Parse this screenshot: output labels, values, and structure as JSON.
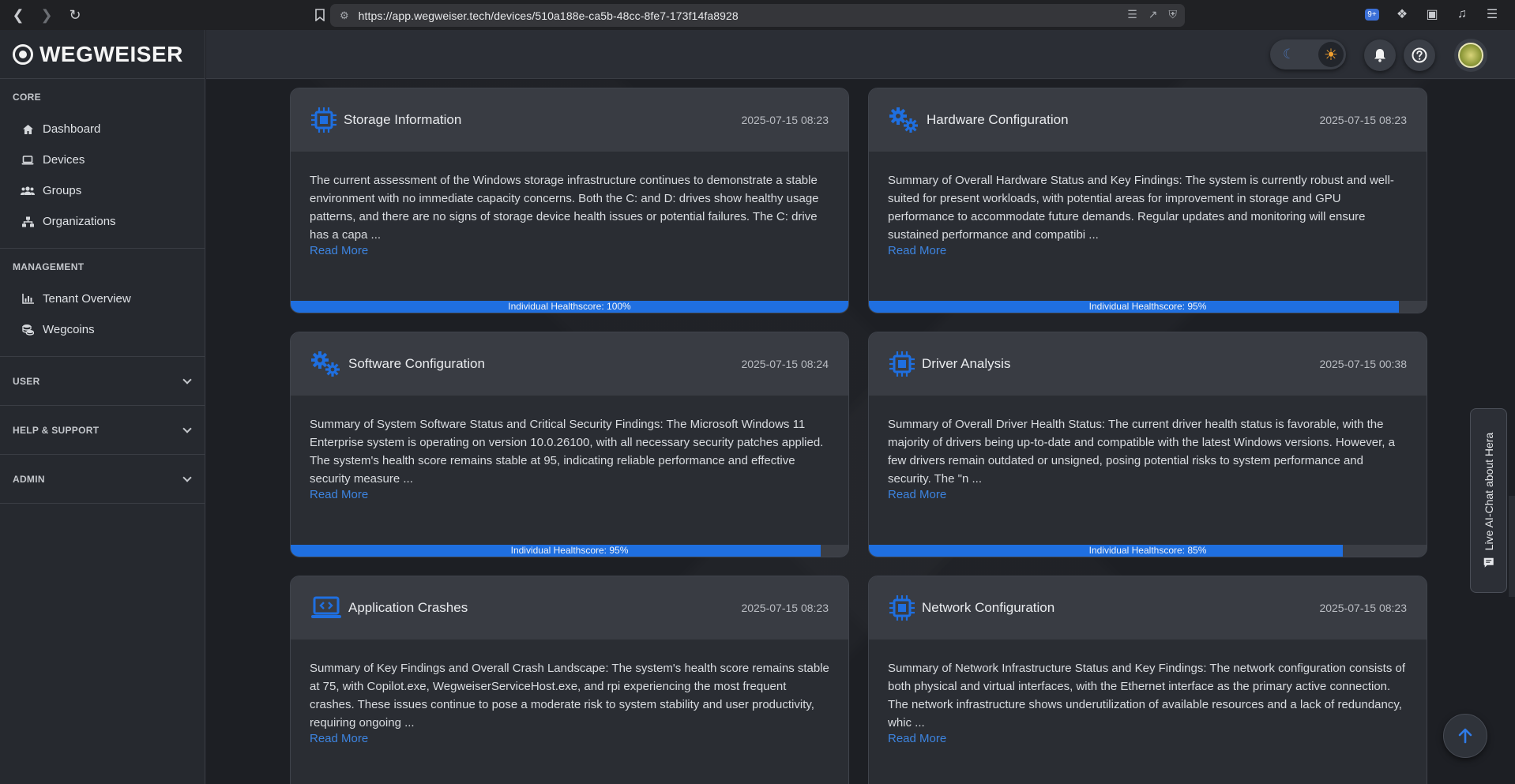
{
  "browser": {
    "url": "https://app.wegweiser.tech/devices/510a188e-ca5b-48cc-8fe7-173f14fa8928",
    "ext_badge": "9+"
  },
  "brand": {
    "name": "WEGWEISER"
  },
  "sidebar": {
    "core": {
      "heading": "CORE",
      "items": [
        {
          "label": "Dashboard",
          "icon": "home-icon"
        },
        {
          "label": "Devices",
          "icon": "laptop-icon"
        },
        {
          "label": "Groups",
          "icon": "users-icon"
        },
        {
          "label": "Organizations",
          "icon": "sitemap-icon"
        }
      ]
    },
    "management": {
      "heading": "MANAGEMENT",
      "items": [
        {
          "label": "Tenant Overview",
          "icon": "chart-icon"
        },
        {
          "label": "Wegcoins",
          "icon": "coins-icon"
        }
      ]
    },
    "collapsibles": [
      "USER",
      "HELP & SUPPORT",
      "ADMIN"
    ]
  },
  "cards": [
    {
      "title": "Storage Information",
      "icon": "chip-icon",
      "date": "2025-07-15 08:23",
      "text": "The current assessment of the Windows storage infrastructure continues to demonstrate a stable environment with no immediate capacity concerns. Both the C: and D: drives show healthy usage patterns, and there are no signs of storage device health issues or potential failures. The C: drive has a capa ...",
      "read_more": "Read More",
      "score_label": "Individual Healthscore: 100%",
      "score": 100
    },
    {
      "title": "Hardware Configuration",
      "icon": "gears-icon",
      "date": "2025-07-15 08:23",
      "text": "Summary of Overall Hardware Status and Key Findings: The system is currently robust and well-suited for present workloads, with potential areas for improvement in storage and GPU performance to accommodate future demands. Regular updates and monitoring will ensure sustained performance and compatibi ...",
      "read_more": "Read More",
      "score_label": "Individual Healthscore: 95%",
      "score": 95
    },
    {
      "title": "Software Configuration",
      "icon": "gears-icon",
      "date": "2025-07-15 08:24",
      "text": "Summary of System Software Status and Critical Security Findings: The Microsoft Windows 11 Enterprise system is operating on version 10.0.26100, with all necessary security patches applied. The system's health score remains stable at 95, indicating reliable performance and effective security measure ...",
      "read_more": "Read More",
      "score_label": "Individual Healthscore: 95%",
      "score": 95
    },
    {
      "title": "Driver Analysis",
      "icon": "chip-icon",
      "date": "2025-07-15 00:38",
      "text": "Summary of Overall Driver Health Status: The current driver health status is favorable, with the majority of drivers being up-to-date and compatible with the latest Windows versions. However, a few drivers remain outdated or unsigned, posing potential risks to system performance and security. The \"n ...",
      "read_more": "Read More",
      "score_label": "Individual Healthscore: 85%",
      "score": 85
    },
    {
      "title": "Application Crashes",
      "icon": "laptop-code-icon",
      "date": "2025-07-15 08:23",
      "text": "Summary of Key Findings and Overall Crash Landscape: The system's health score remains stable at 75, with Copilot.exe, WegweiserServiceHost.exe, and rpi experiencing the most frequent crashes. These issues continue to pose a moderate risk to system stability and user productivity, requiring ongoing ...",
      "read_more": "Read More",
      "score_label": "",
      "score": null
    },
    {
      "title": "Network Configuration",
      "icon": "chip-icon",
      "date": "2025-07-15 08:23",
      "text": "Summary of Network Infrastructure Status and Key Findings: The network configuration consists of both physical and virtual interfaces, with the Ethernet interface as the primary active connection. The network infrastructure shows underutilization of available resources and a lack of redundancy, whic ...",
      "read_more": "Read More",
      "score_label": "",
      "score": null
    }
  ],
  "live_chat": {
    "label": "Live AI-Chat about Hera"
  },
  "colors": {
    "accent": "#1f6fe0",
    "link": "#3d84e0",
    "sun": "#f0a030"
  }
}
